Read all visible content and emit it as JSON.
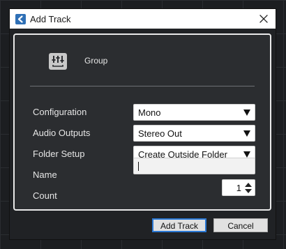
{
  "window": {
    "title": "Add Track",
    "app_icon": "cubase-logo-icon",
    "close_icon": "close-icon"
  },
  "track_type": {
    "icon": "group-channel-icon",
    "label": "Group"
  },
  "fields": {
    "configuration": {
      "label": "Configuration",
      "value": "Mono"
    },
    "audio_outputs": {
      "label": "Audio Outputs",
      "value": "Stereo Out"
    },
    "folder_setup": {
      "label": "Folder Setup",
      "value": "Create Outside Folder"
    },
    "name": {
      "label": "Name",
      "value": ""
    },
    "count": {
      "label": "Count",
      "value": "1"
    }
  },
  "buttons": {
    "add_track": "Add Track",
    "cancel": "Cancel"
  },
  "colors": {
    "accent": "#2b78d4",
    "app_icon": "#2f70b6",
    "panel_background": "#2b2d30"
  }
}
